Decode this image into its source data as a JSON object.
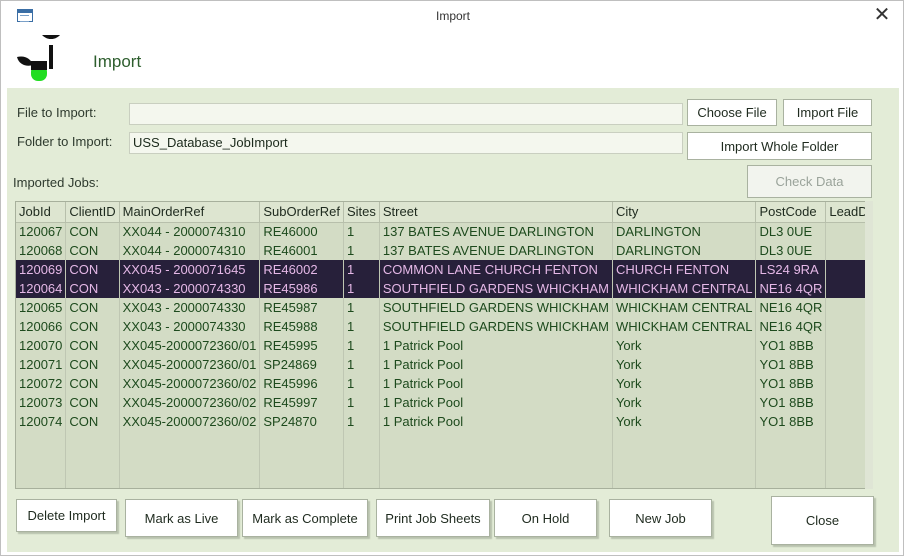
{
  "window": {
    "title": "Import"
  },
  "header": {
    "title": "Import"
  },
  "fields": {
    "file_label": "File to Import:",
    "file_value": "",
    "folder_label": "Folder to Import:",
    "folder_value": "USS_Database_JobImport",
    "imported_label": "Imported Jobs:"
  },
  "buttons": {
    "choose_file": "Choose File",
    "import_file": "Import File",
    "import_folder": "Import Whole Folder",
    "check_data": "Check Data",
    "delete_import": "Delete Import",
    "mark_live": "Mark as Live",
    "mark_complete": "Mark as Complete",
    "print_sheets": "Print Job Sheets",
    "on_hold": "On Hold",
    "new_job": "New Job",
    "close": "Close"
  },
  "table": {
    "columns": [
      "JobId",
      "ClientID",
      "MainOrderRef",
      "SubOrderRef",
      "Sites",
      "Street",
      "City",
      "PostCode",
      "LeadDays"
    ],
    "rows": [
      [
        "120067",
        "CON",
        "XX044 - 2000074310",
        "RE46000",
        "1",
        "137 BATES AVENUE DARLINGTON",
        "DARLINGTON",
        "DL3 0UE",
        ""
      ],
      [
        "120068",
        "CON",
        "XX044 - 2000074310",
        "RE46001",
        "1",
        "137 BATES AVENUE DARLINGTON",
        "DARLINGTON",
        "DL3 0UE",
        ""
      ],
      [
        "120069",
        "CON",
        "XX045 - 2000071645",
        "RE46002",
        "1",
        "COMMON LANE CHURCH FENTON",
        "CHURCH FENTON",
        "LS24 9RA",
        ""
      ],
      [
        "120064",
        "CON",
        "XX043 - 2000074330",
        "RE45986",
        "1",
        "SOUTHFIELD GARDENS WHICKHAM",
        "WHICKHAM CENTRAL",
        "NE16 4QR",
        ""
      ],
      [
        "120065",
        "CON",
        "XX043 - 2000074330",
        "RE45987",
        "1",
        "SOUTHFIELD GARDENS WHICKHAM",
        "WHICKHAM CENTRAL",
        "NE16 4QR",
        ""
      ],
      [
        "120066",
        "CON",
        "XX043 - 2000074330",
        "RE45988",
        "1",
        "SOUTHFIELD GARDENS WHICKHAM",
        "WHICKHAM CENTRAL",
        "NE16 4QR",
        ""
      ],
      [
        "120070",
        "CON",
        "XX045-2000072360/01",
        "RE45995",
        "1",
        "1 Patrick Pool",
        "York",
        "YO1 8BB",
        ""
      ],
      [
        "120071",
        "CON",
        "XX045-2000072360/01",
        "SP24869",
        "1",
        "1 Patrick Pool",
        "York",
        "YO1 8BB",
        ""
      ],
      [
        "120072",
        "CON",
        "XX045-2000072360/02",
        "RE45996",
        "1",
        "1 Patrick Pool",
        "York",
        "YO1 8BB",
        ""
      ],
      [
        "120073",
        "CON",
        "XX045-2000072360/02",
        "RE45997",
        "1",
        "1 Patrick Pool",
        "York",
        "YO1 8BB",
        ""
      ],
      [
        "120074",
        "CON",
        "XX045-2000072360/02",
        "SP24870",
        "1",
        "1 Patrick Pool",
        "York",
        "YO1 8BB",
        ""
      ]
    ],
    "selected_rows": [
      2,
      3
    ]
  },
  "colors": {
    "client_bg": "#e3ecd7",
    "selected_row_bg": "#27203a",
    "selected_row_text": "#e5b8e7",
    "cell_text": "#1d4a1d",
    "logo_green": "#22dd22"
  },
  "icons": [
    "app-form-icon",
    "close-icon",
    "logo-icon"
  ]
}
